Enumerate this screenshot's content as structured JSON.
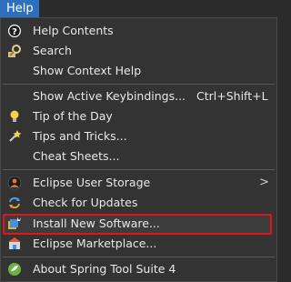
{
  "menubar": {
    "help_label": "Help"
  },
  "menu": {
    "items": [
      {
        "label": "Help Contents",
        "icon": "help-contents-icon"
      },
      {
        "label": "Search",
        "icon": "search-icon"
      },
      {
        "label": "Show Context Help",
        "icon": ""
      },
      {
        "label": "Show Active Keybindings...",
        "shortcut": "Ctrl+Shift+L",
        "icon": ""
      },
      {
        "label": "Tip of the Day",
        "icon": "lightbulb-icon"
      },
      {
        "label": "Tips and Tricks...",
        "icon": "tips-tricks-icon"
      },
      {
        "label": "Cheat Sheets...",
        "icon": ""
      },
      {
        "label": "Eclipse User Storage",
        "submenu_arrow": ">",
        "icon": "user-storage-icon"
      },
      {
        "label": "Check for Updates",
        "icon": "check-updates-icon"
      },
      {
        "label": "Install New Software...",
        "icon": "install-software-icon",
        "highlighted": true
      },
      {
        "label": "Eclipse Marketplace...",
        "icon": "marketplace-icon"
      },
      {
        "label": "About Spring Tool Suite 4",
        "icon": "spring-icon"
      }
    ]
  },
  "colors": {
    "menubar_selected": "#2f6fbf",
    "menu_background": "#333333",
    "highlight_border": "#e0151a",
    "text": "#e8e8e8"
  }
}
